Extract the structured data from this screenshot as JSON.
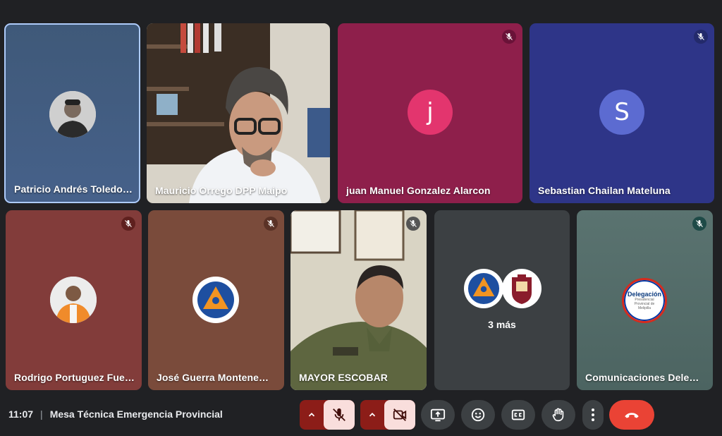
{
  "participants": [
    {
      "name": "Patricio Andrés Toledo…",
      "avatar": "photo-person-icon",
      "muted": false,
      "bg": "#3d5676"
    },
    {
      "name": "Mauricio Orrego DPP Maipo",
      "avatar": "video-feed",
      "muted": false,
      "bg": "#6b6356"
    },
    {
      "name": "juan Manuel Gonzalez Alarcon",
      "avatar_letter": "j",
      "muted": true,
      "bg": "#8e1f4b",
      "avatar_color": "#e3356e"
    },
    {
      "name": "Sebastian Chailan Mateluna",
      "avatar_letter": "S",
      "muted": true,
      "bg": "#2e3588",
      "avatar_color": "#5c6bd1"
    },
    {
      "name": "Rodrigo Portuguez Fue…",
      "avatar": "photo-person-icon",
      "muted": true,
      "bg": "#823c3a"
    },
    {
      "name": "José Guerra Montene…",
      "avatar": "emergency-logo-icon",
      "muted": true,
      "bg": "#7a4b3b"
    },
    {
      "name": "MAYOR ESCOBAR",
      "avatar": "video-feed",
      "muted": true,
      "bg": "#b7b4a6"
    },
    {
      "name": "",
      "extra_label": "3 más",
      "muted": false,
      "bg": "#3c4043"
    },
    {
      "name": "Comunicaciones Dele…",
      "avatar": "delegacion-logo-icon",
      "muted": true,
      "bg": "#4e6a68"
    }
  ],
  "logo_text": {
    "line1": "Delegación",
    "line2": "Presidencial",
    "line3": "Provincial de",
    "line4": "Melipilla"
  },
  "toolbar": {
    "time": "11:07",
    "separator": "|",
    "meeting_title": "Mesa Técnica Emergencia Provincial"
  },
  "colors": {
    "mic_off_red": "#8c1d18",
    "mic_off_blue": "#28306b",
    "mic_off_teal": "#1e4a47",
    "end_call": "#ea4335"
  }
}
